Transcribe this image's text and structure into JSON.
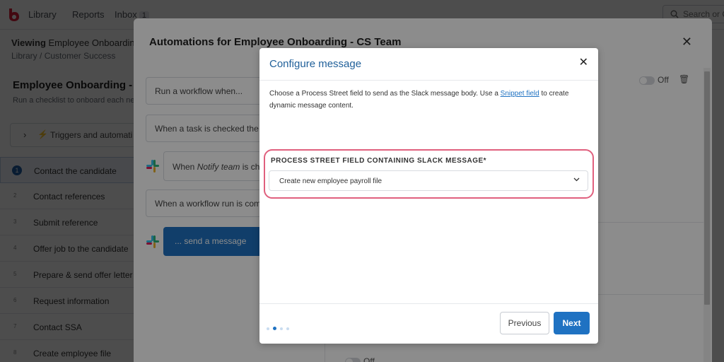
{
  "topbar": {
    "nav": [
      "Library",
      "Reports",
      "Inbox"
    ],
    "inbox_count": "1",
    "search_placeholder": "Search or C"
  },
  "viewing": {
    "label": "Viewing",
    "name": "Employee Onboarding"
  },
  "breadcrumb": {
    "library": "Library",
    "separator": "/",
    "folder": "Customer Success"
  },
  "checklist": {
    "title": "Employee Onboarding - C",
    "subtitle": "Run a checklist to onboard each new",
    "triggers_label": "Triggers and automati",
    "tasks": [
      {
        "num": "1",
        "label": "Contact the candidate"
      },
      {
        "num": "2",
        "label": "Contact references"
      },
      {
        "num": "3",
        "label": "Submit reference"
      },
      {
        "num": "4",
        "label": "Offer job to the candidate"
      },
      {
        "num": "5",
        "label": "Prepare & send offer letter"
      },
      {
        "num": "6",
        "label": "Request information"
      },
      {
        "num": "7",
        "label": "Contact SSA"
      },
      {
        "num": "8",
        "label": "Create employee file"
      }
    ]
  },
  "automations_modal": {
    "title": "Automations for Employee Onboarding - CS Team",
    "run_workflow": "Run a workflow when...",
    "when_task_checked": "When a task is checked the",
    "when_notify": "When ",
    "when_notify_em": "Notify team",
    "when_notify_rest": " is ch",
    "when_workflow_run": "When a workflow run is com",
    "send_message": "... send a message",
    "toggle_off": "Off",
    "toggle_off_bottom": "Off"
  },
  "config_modal": {
    "title": "Configure message",
    "desc_before": "Choose a Process Street field to send as the Slack message body. Use a ",
    "desc_link": "Snippet field",
    "desc_after": " to create dynamic message content.",
    "field_label": "PROCESS STREET FIELD CONTAINING SLACK MESSAGE*",
    "field_value": "Create new employee payroll file",
    "previous": "Previous",
    "next": "Next",
    "step_current": 2,
    "step_total": 4
  },
  "colors": {
    "accent": "#1f72c2",
    "highlight": "#e0607e",
    "title_blue": "#1f5f99"
  },
  "icons": [
    "logo-icon",
    "search-icon",
    "close-icon",
    "chevron-right-icon",
    "bolt-icon",
    "slack-icon",
    "trash-icon",
    "chevron-down-icon"
  ]
}
